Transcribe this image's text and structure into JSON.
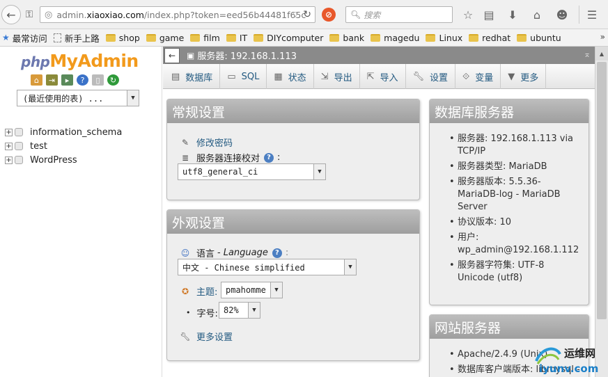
{
  "browser": {
    "url_prefix": "admin.",
    "url_host": "xiaoxiao.com",
    "url_path": "/index.php?token=eed56b44481f65c",
    "search_placeholder": "搜索"
  },
  "bookmarks": [
    {
      "label": "最常访问",
      "kind": "star"
    },
    {
      "label": "新手上路",
      "kind": "page"
    },
    {
      "label": "shop",
      "kind": "folder"
    },
    {
      "label": "game",
      "kind": "folder"
    },
    {
      "label": "film",
      "kind": "folder"
    },
    {
      "label": "IT",
      "kind": "folder"
    },
    {
      "label": "DIYcomputer",
      "kind": "folder"
    },
    {
      "label": "bank",
      "kind": "folder"
    },
    {
      "label": "magedu",
      "kind": "folder"
    },
    {
      "label": "Linux",
      "kind": "folder"
    },
    {
      "label": "redhat",
      "kind": "folder"
    },
    {
      "label": "ubuntu",
      "kind": "folder"
    }
  ],
  "nav": {
    "logo_php": "php",
    "logo_myadmin": "MyAdmin",
    "recent_tables": "(最近使用的表) ...",
    "databases": [
      "information_schema",
      "test",
      "WordPress"
    ]
  },
  "server_bar": {
    "label": "服务器: 192.168.1.113"
  },
  "tabs": [
    {
      "label": "数据库",
      "icon": "database-icon"
    },
    {
      "label": "SQL",
      "icon": "sql-icon"
    },
    {
      "label": "状态",
      "icon": "status-icon"
    },
    {
      "label": "导出",
      "icon": "export-icon"
    },
    {
      "label": "导入",
      "icon": "import-icon"
    },
    {
      "label": "设置",
      "icon": "wrench-icon"
    },
    {
      "label": "变量",
      "icon": "variables-icon"
    },
    {
      "label": "更多",
      "icon": "more-icon"
    }
  ],
  "general": {
    "title": "常规设置",
    "change_password": "修改密码",
    "collation_label": "服务器连接校对",
    "collation_value": "utf8_general_ci"
  },
  "appearance": {
    "title": "外观设置",
    "language_label": "语言",
    "language_en": "Language",
    "language_value": "中文 - Chinese simplified",
    "theme_label": "主题:",
    "theme_value": "pmahomme",
    "fontsize_label": "字号:",
    "fontsize_value": "82%",
    "more_settings": "更多设置"
  },
  "dbserver": {
    "title": "数据库服务器",
    "items": [
      "服务器: 192.168.1.113 via TCP/IP",
      "服务器类型: MariaDB",
      "服务器版本: 5.5.36-MariaDB-log - MariaDB Server",
      "协议版本: 10",
      "用户: wp_admin@192.168.1.112",
      "服务器字符集: UTF-8 Unicode (utf8)"
    ]
  },
  "webserver": {
    "title": "网站服务器",
    "items": [
      "Apache/2.4.9 (Unix)",
      "数据库客户端版本: libmysql -"
    ]
  },
  "watermark": {
    "line1": "运维网",
    "line2": "iyunv.com"
  }
}
